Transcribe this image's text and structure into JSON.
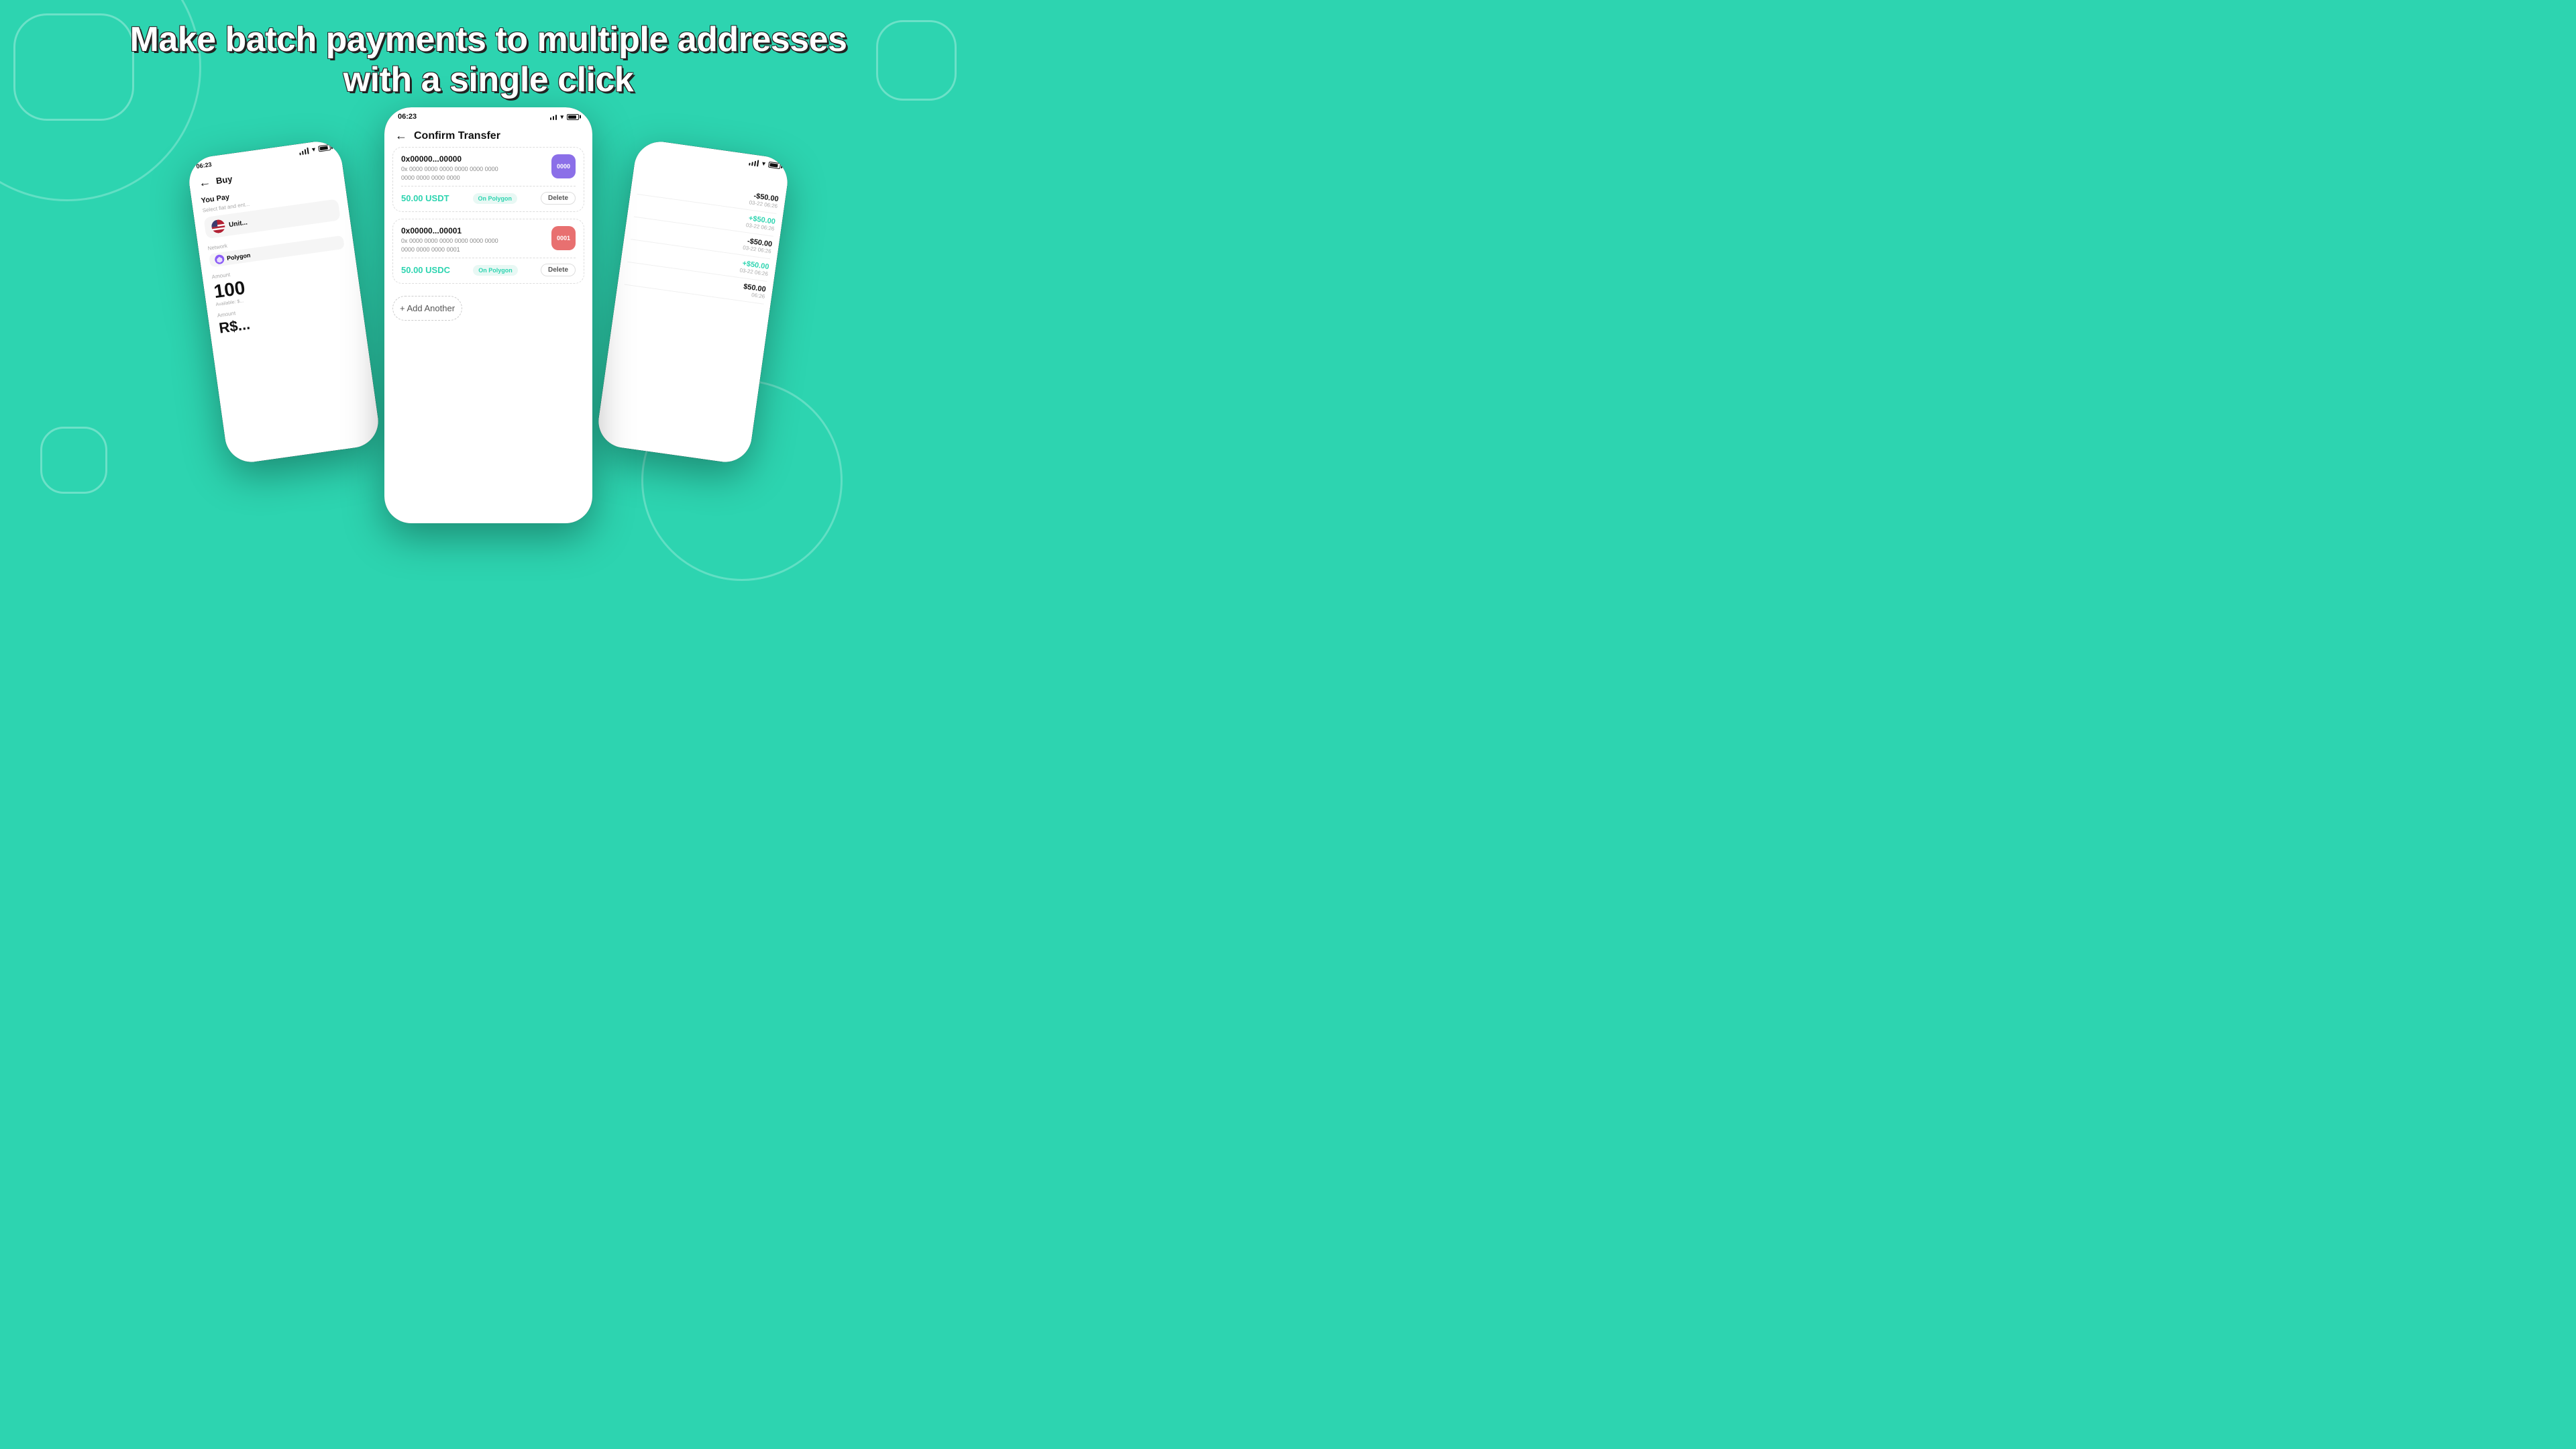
{
  "page": {
    "background_color": "#2DD4B0",
    "headline_line1": "Make batch payments to multiple addresses",
    "headline_line2": "with a single click"
  },
  "phone_center": {
    "status_bar": {
      "time": "06:23"
    },
    "header": {
      "back_label": "←",
      "title": "Confirm Transfer"
    },
    "transfers": [
      {
        "address_short": "0x00000...00000",
        "address_full": "0x 0000 0000 0000 0000 0000 0000 0000 0000 0000 0000 0000 0000",
        "avatar_label": "0000",
        "avatar_class": "avatar-0",
        "amount": "50.00 USDT",
        "network": "On Polygon",
        "delete_label": "Delete"
      },
      {
        "address_short": "0x00000...00001",
        "address_full": "0x 0000 0000 0000 0000 0000 0000 0000 0000 0000 0000 0000 0001",
        "avatar_label": "0001",
        "avatar_class": "avatar-1",
        "amount": "50.00 USDC",
        "network": "On Polygon",
        "delete_label": "Delete"
      }
    ],
    "add_another_label": "+ Add Another"
  },
  "phone_left": {
    "status_bar": {
      "time": "06:23"
    },
    "header": {
      "back_label": "←",
      "title": "Buy"
    },
    "you_pay_label": "You Pay",
    "you_pay_sub": "Select fiat and ent...",
    "currency": {
      "code": "Unit...",
      "flag": "US"
    },
    "network_label": "Network",
    "network_name": "Polygon",
    "amount_label": "Amount",
    "amount_value": "100",
    "available_label": "Available: $...",
    "amount_label2": "Amount",
    "amount_brl": "R$..."
  },
  "phone_right": {
    "status_bar": {
      "time": ""
    },
    "transactions": [
      {
        "amount": "-$50.00",
        "date": "03-22 06:26",
        "type": "negative"
      },
      {
        "amount": "+$50.00",
        "date": "03-22 06:26",
        "type": "positive"
      },
      {
        "amount": "-$50.00",
        "date": "03-22 06:26",
        "type": "negative"
      },
      {
        "amount": "+$50.00",
        "date": "03-22 06:26",
        "type": "positive"
      },
      {
        "amount": "$50.00",
        "date": "06:26",
        "type": "negative"
      }
    ]
  },
  "colors": {
    "accent": "#2DD4B0",
    "negative": "#111111",
    "positive": "#2DD4B0"
  }
}
